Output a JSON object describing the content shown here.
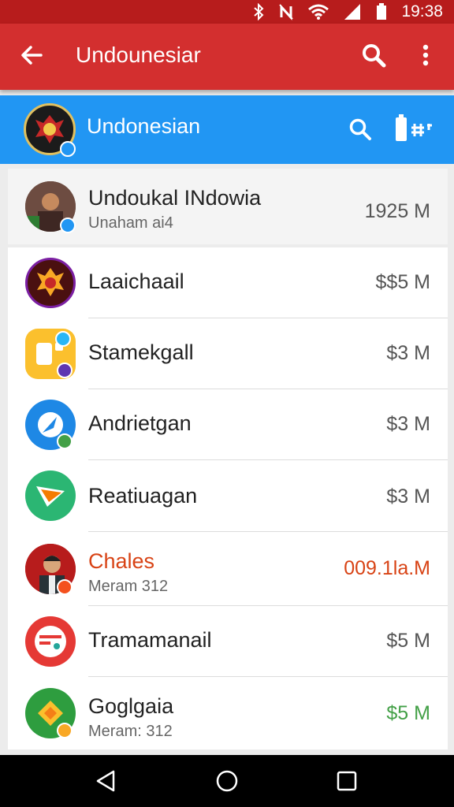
{
  "status_bar": {
    "time": "19:38",
    "icons": [
      "bluetooth-icon",
      "no-notification-icon",
      "wifi-icon",
      "signal-icon",
      "battery-icon"
    ]
  },
  "app_bar": {
    "title": "Undounesiar",
    "icons": [
      "back-arrow-icon",
      "search-icon",
      "more-vert-icon"
    ]
  },
  "sub_bar": {
    "title": "Undonesian",
    "icons": [
      "search-icon",
      "battery-icon"
    ]
  },
  "header_item": {
    "name": "Undoukal INdowia",
    "sub": "Unaham ai4",
    "amount": "1925 M"
  },
  "list": [
    {
      "name": "Laaichaail",
      "amount": "$$5 M",
      "icon": "garuda-emblem-icon"
    },
    {
      "name": "Stamekgall",
      "amount": "$3 M",
      "icon": "yellow-app-icon"
    },
    {
      "name": "Andrietgan",
      "amount": "$3 M",
      "icon": "blue-navigation-app-icon"
    },
    {
      "name": "Reatiuagan",
      "amount": "$3 M",
      "icon": "green-play-app-icon"
    },
    {
      "name": "Chales",
      "sub": "Meram 312",
      "amount": "009.1la.M",
      "icon": "person-avatar"
    },
    {
      "name": "Tramamanail",
      "amount": "$5 M",
      "icon": "red-mail-app-icon"
    },
    {
      "name": "Goglgaia",
      "sub": "Meram: 312",
      "amount": "$5 M",
      "icon": "green-diamond-app-icon"
    }
  ],
  "colors": {
    "status_bar": "#b71c1c",
    "app_bar": "#d32f2f",
    "sub_bar": "#2196f3",
    "highlight_text": "#d84315",
    "positive_amount": "#43a047"
  },
  "nav": {
    "icons": [
      "back-triangle-icon",
      "home-circle-icon",
      "recents-square-icon"
    ]
  }
}
